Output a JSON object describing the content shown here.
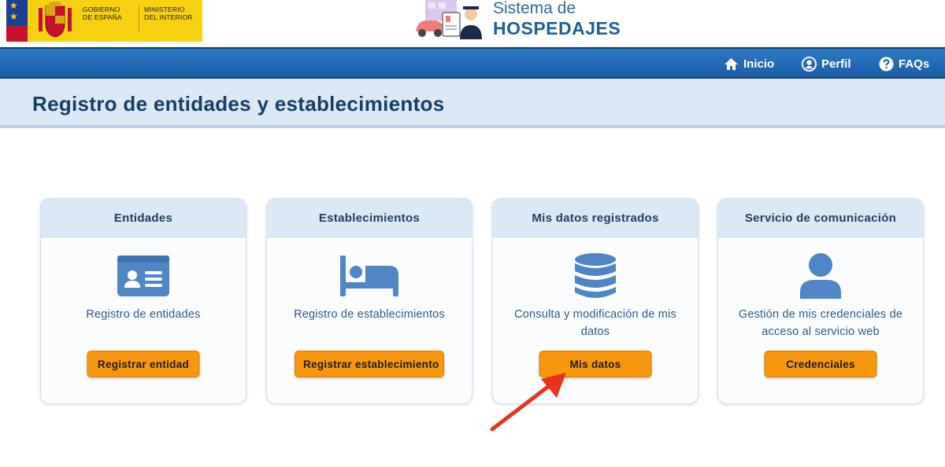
{
  "header": {
    "gov_logo": {
      "line1a": "GOBIERNO",
      "line1b": "DE ESPAÑA",
      "line2a": "MINISTERIO",
      "line2b": "DEL INTERIOR"
    },
    "brand": {
      "line1": "Sistema de",
      "line2": "HOSPEDAJES"
    }
  },
  "nav": {
    "items": [
      {
        "label": "Inicio",
        "icon": "home-icon"
      },
      {
        "label": "Perfil",
        "icon": "user-circle-icon"
      },
      {
        "label": "FAQs",
        "icon": "question-circle-icon"
      }
    ]
  },
  "page": {
    "title": "Registro de entidades y establecimientos"
  },
  "cards": [
    {
      "title": "Entidades",
      "icon": "id-card-icon",
      "desc": "Registro de entidades",
      "button": "Registrar entidad"
    },
    {
      "title": "Establecimientos",
      "icon": "bed-icon",
      "desc": "Registro de establecimientos",
      "button": "Registrar establecimiento"
    },
    {
      "title": "Mis datos registrados",
      "icon": "database-icon",
      "desc": "Consulta y modificación de mis datos",
      "button": "Mis datos"
    },
    {
      "title": "Servicio de comunicación",
      "icon": "user-icon",
      "desc": "Gestión de mis credenciales de acceso al servicio web",
      "button": "Credenciales"
    }
  ],
  "annotation": {
    "arrow_target": "Mis datos",
    "arrow_color": "#e8321e"
  },
  "colors": {
    "nav_blue": "#1f64ad",
    "accent_orange": "#f8960e",
    "card_header": "#dbe8f5",
    "icon_blue": "#4f86c6"
  }
}
